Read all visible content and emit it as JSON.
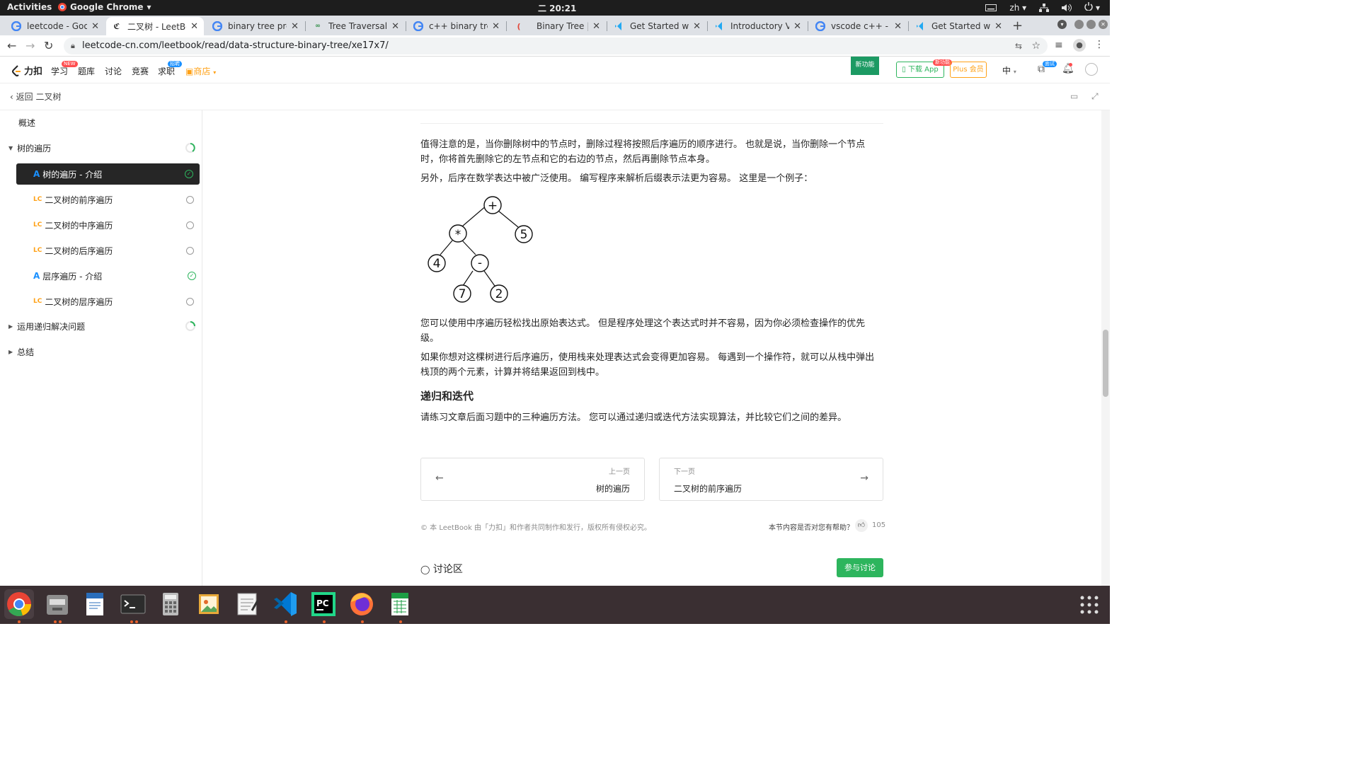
{
  "topbar": {
    "activities": "Activities",
    "app": "Google Chrome",
    "clock": "二 20:21",
    "lang": "zh"
  },
  "tabs": [
    {
      "title": "leetcode - Goog",
      "icon": "google-icon"
    },
    {
      "title": "二叉树 - LeetBo",
      "icon": "leetcode-icon",
      "active": true
    },
    {
      "title": "binary tree pre",
      "icon": "google-icon"
    },
    {
      "title": "Tree Traversals",
      "icon": "gfg-icon"
    },
    {
      "title": "c++ binary tree",
      "icon": "google-icon"
    },
    {
      "title": "Binary Tree | Se",
      "icon": "loading-icon"
    },
    {
      "title": "Get Started with",
      "icon": "vscode-icon"
    },
    {
      "title": "Introductory Vi",
      "icon": "vscode-icon"
    },
    {
      "title": "vscode c++ - Goo",
      "icon": "google-icon"
    },
    {
      "title": "Get Started wit",
      "icon": "vscode-icon"
    }
  ],
  "address": {
    "url": "leetcode-cn.com/leetbook/read/data-structure-binary-tree/xe17x7/"
  },
  "header": {
    "logo": "力扣",
    "nav": [
      "学习",
      "题库",
      "讨论",
      "竞赛",
      "求职",
      "商店"
    ],
    "learn_badge": "NEW",
    "job_badge": "招聘",
    "new_feature": "新功能",
    "download": "下载 App",
    "download_badge": "新功能",
    "plus": "Plus 会员",
    "lang": "中",
    "interview_badge": "面试"
  },
  "subheader": {
    "back": "返回 二叉树"
  },
  "sidebar": {
    "overview": "概述",
    "section1": "树的遍历",
    "items": [
      {
        "type": "A",
        "label": "树的遍历 - 介绍",
        "status": "done",
        "active": true
      },
      {
        "type": "LC",
        "label": "二叉树的前序遍历",
        "status": "todo"
      },
      {
        "type": "LC",
        "label": "二叉树的中序遍历",
        "status": "todo"
      },
      {
        "type": "LC",
        "label": "二叉树的后序遍历",
        "status": "todo"
      },
      {
        "type": "A",
        "label": "层序遍历 - 介绍",
        "status": "done"
      },
      {
        "type": "LC",
        "label": "二叉树的层序遍历",
        "status": "todo"
      }
    ],
    "section2": "运用递归解决问题",
    "section3": "总结"
  },
  "article": {
    "p1": "值得注意的是，当你删除树中的节点时，删除过程将按照后序遍历的顺序进行。 也就是说，当你删除一个节点时，你将首先删除它的左节点和它的右边的节点，然后再删除节点本身。",
    "p2": "另外，后序在数学表达中被广泛使用。 编写程序来解析后缀表示法更为容易。 这里是一个例子：",
    "tree": {
      "root": "+",
      "l": "*",
      "r": "5",
      "ll": "4",
      "lr": "-",
      "lrl": "7",
      "lrr": "2"
    },
    "p3": "您可以使用中序遍历轻松找出原始表达式。 但是程序处理这个表达式时并不容易，因为你必须检查操作的优先级。",
    "p4": "如果你想对这棵树进行后序遍历，使用栈来处理表达式会变得更加容易。 每遇到一个操作符，就可以从栈中弹出栈顶的两个元素，计算并将结果返回到栈中。",
    "h_recursion": "递归和迭代",
    "p5": "请练习文章后面习题中的三种遍历方法。 您可以通过递归或迭代方法实现算法，并比较它们之间的差异。",
    "prev_label": "上一页",
    "prev_title": "树的遍历",
    "next_label": "下一页",
    "next_title": "二叉树的前序遍历",
    "copyright": "© 本 LeetBook 由「力扣」和作者共同制作和发行，版权所有侵权必究。",
    "helpful": "本节内容是否对您有帮助？",
    "likes": "105",
    "discussion": "讨论区",
    "join": "参与讨论"
  },
  "colors": {
    "accent": "#2db55d",
    "brand": "#ffa116",
    "dark": "#262626"
  }
}
